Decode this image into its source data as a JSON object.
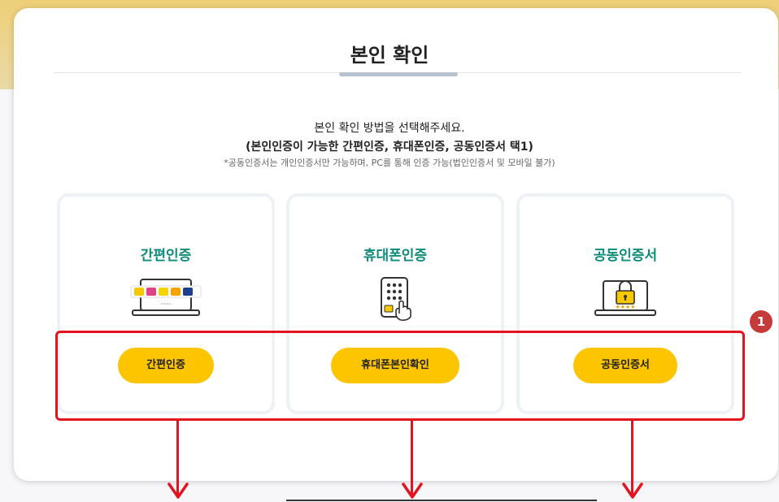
{
  "header": {
    "title": "본인 확인"
  },
  "description": {
    "line1": "본인 확인 방법을 선택해주세요.",
    "line2": "(본인인증이 가능한 간편인증, 휴대폰인증, 공동인증서 택1)",
    "note": "*공동인증서는 개인인증서만 가능하며, PC를 통해 인증 가능(법인인증서 및 모바일 불가)"
  },
  "cards": [
    {
      "title": "간편인증",
      "button": "간편인증",
      "icon": "simple-auth-laptop-icon"
    },
    {
      "title": "휴대폰인증",
      "button": "휴대폰본인확인",
      "icon": "phone-keypad-icon"
    },
    {
      "title": "공동인증서",
      "button": "공동인증서",
      "icon": "certificate-lock-laptop-icon"
    }
  ],
  "annotation": {
    "badge": "1"
  },
  "colors": {
    "accent_yellow": "#fdc400",
    "card_title_green": "#0f8c79",
    "highlight_red": "#e3131f"
  }
}
